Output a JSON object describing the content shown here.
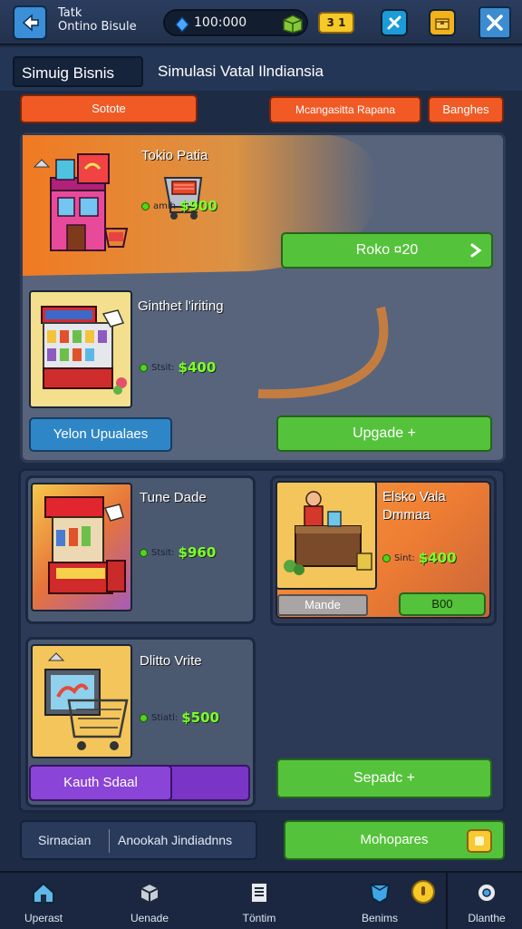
{
  "header": {
    "title_line1": "Tatk",
    "title_line2": "Ontino Bisule",
    "currency_value": "100:000",
    "gold_chip": "3 1",
    "icons": [
      "back-icon",
      "gem-icon",
      "cash-box-icon",
      "diamond-tool-icon",
      "chest-icon",
      "close-icon"
    ]
  },
  "tabs": {
    "active": "Simuig Bisnis",
    "other": "Simulasi Vatal Ilndiansia"
  },
  "filters": {
    "left": "Sotote",
    "mid": "Mcangasitta Rapana",
    "right": "Banghes"
  },
  "featured": {
    "item1": {
      "name": "Tokio Patia",
      "price_prefix": "amih",
      "price": "$900",
      "button": "Roko ¤20"
    },
    "item2": {
      "name": "Ginthet l'iriting",
      "price_prefix": "Stsit:",
      "price": "$400"
    },
    "btn_left": "Yelon Upualaes",
    "btn_right": "Upgade +"
  },
  "grid": {
    "card1": {
      "name": "Tune Dade",
      "price_prefix": "Stsit:",
      "price": "$960"
    },
    "card2": {
      "name_line1": "Elsko Vala",
      "name_line2": "Dmmaa",
      "price_prefix": "Sint:",
      "price": "$400",
      "btn_left": "Mande",
      "btn_right": "B00"
    },
    "card3": {
      "name": "Dlitto Vrite",
      "price_prefix": "Stiatl:",
      "price": "$500",
      "btn_left": "Kauth Sdaal"
    },
    "btn_right": "Sepadc +"
  },
  "footer_bar": {
    "left1": "Sirnacian",
    "left2": "Anookah Jindiadnns",
    "right": "Mohopares"
  },
  "nav": [
    {
      "label": "Uperast",
      "icon": "home-icon"
    },
    {
      "label": "Uenade",
      "icon": "cube-icon"
    },
    {
      "label": "Töntim",
      "icon": "document-icon"
    },
    {
      "label": "Benims",
      "icon": "shield-icon"
    },
    {
      "label": "Dlanthe",
      "icon": "settings-icon"
    }
  ],
  "colors": {
    "accent_orange": "#f15a25",
    "accent_green": "#55c23b",
    "accent_blue": "#2f86c7",
    "accent_purple": "#7a35c7",
    "price_green": "#7dff2b"
  }
}
